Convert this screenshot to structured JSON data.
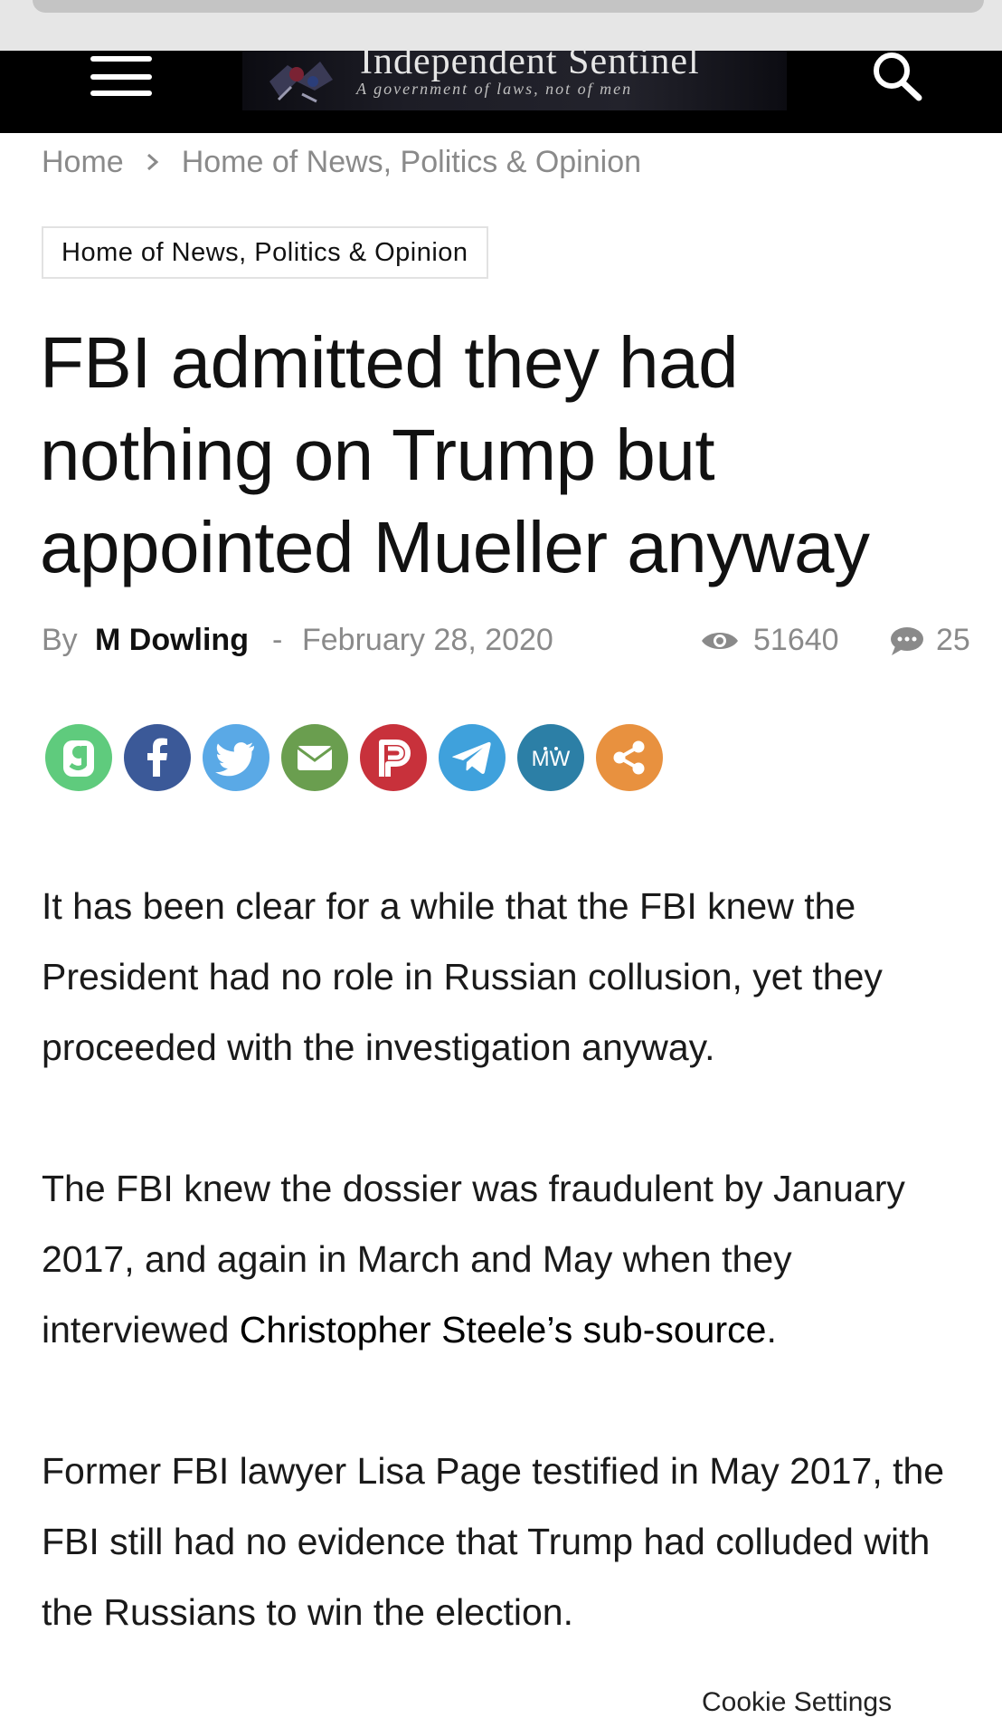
{
  "header": {
    "logo_title": "Independent Sentinel",
    "logo_tagline": "A government of laws, not of men",
    "menu_icon": "hamburger-menu-icon",
    "search_icon": "search-icon",
    "background": "#000000"
  },
  "breadcrumb": {
    "items": [
      "Home",
      "Home of News, Politics & Opinion"
    ],
    "separator_icon": "chevron-right-icon"
  },
  "category": "Home of News, Politics & Opinion",
  "article": {
    "title": "FBI admitted they had nothing on Trump but appointed Mueller anyway",
    "by_label": "By",
    "author": "M Dowling",
    "dash": "-",
    "date": "February 28, 2020",
    "views": "51640",
    "comments": "25",
    "views_icon": "eye-icon",
    "comments_icon": "speech-bubble-icon",
    "paragraphs": [
      {
        "text": "It has been clear for a while that the FBI knew the President had no role in Russian collusion, yet they proceeded with the investigation anyway."
      },
      {
        "before": "The FBI knew the dossier was fraudulent by January 2017, and again in March and May when they interviewed ",
        "link": "Christopher Steele’s sub-source",
        "after": "."
      },
      {
        "text": "Former FBI lawyer Lisa Page testified in May 2017, the FBI still had no evidence that Trump had colluded with the Russians to win the election."
      }
    ]
  },
  "share_buttons": [
    {
      "name": "gab",
      "icon": "gab-icon",
      "color": "#5fcb7d"
    },
    {
      "name": "facebook",
      "icon": "facebook-icon",
      "color": "#3b5998"
    },
    {
      "name": "twitter",
      "icon": "twitter-icon",
      "color": "#5aa9e6"
    },
    {
      "name": "email",
      "icon": "email-icon",
      "color": "#6a9e4f"
    },
    {
      "name": "parler",
      "icon": "parler-icon",
      "color": "#c8313b"
    },
    {
      "name": "telegram",
      "icon": "telegram-icon",
      "color": "#3fa1dc"
    },
    {
      "name": "mewe",
      "icon": "mewe-icon",
      "color": "#2c7fa6"
    },
    {
      "name": "more-share",
      "icon": "share-icon",
      "color": "#e8913f"
    }
  ],
  "cookie_settings": "Cookie Settings"
}
